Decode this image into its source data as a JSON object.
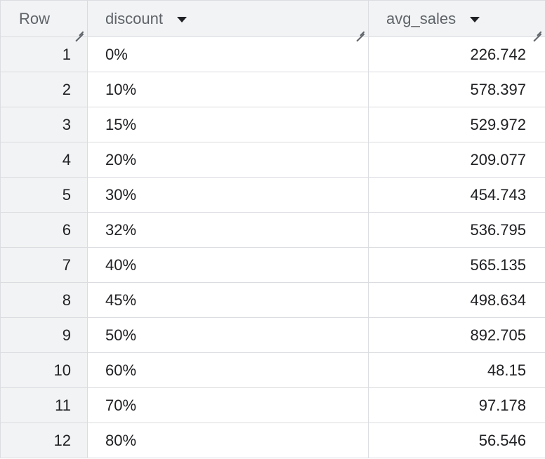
{
  "table": {
    "columns": {
      "row": "Row",
      "discount": "discount",
      "avg_sales": "avg_sales"
    },
    "rows": [
      {
        "row": "1",
        "discount": "0%",
        "avg_sales": "226.742"
      },
      {
        "row": "2",
        "discount": "10%",
        "avg_sales": "578.397"
      },
      {
        "row": "3",
        "discount": "15%",
        "avg_sales": "529.972"
      },
      {
        "row": "4",
        "discount": "20%",
        "avg_sales": "209.077"
      },
      {
        "row": "5",
        "discount": "30%",
        "avg_sales": "454.743"
      },
      {
        "row": "6",
        "discount": "32%",
        "avg_sales": "536.795"
      },
      {
        "row": "7",
        "discount": "40%",
        "avg_sales": "565.135"
      },
      {
        "row": "8",
        "discount": "45%",
        "avg_sales": "498.634"
      },
      {
        "row": "9",
        "discount": "50%",
        "avg_sales": "892.705"
      },
      {
        "row": "10",
        "discount": "60%",
        "avg_sales": "48.15"
      },
      {
        "row": "11",
        "discount": "70%",
        "avg_sales": "97.178"
      },
      {
        "row": "12",
        "discount": "80%",
        "avg_sales": "56.546"
      }
    ]
  },
  "colors": {
    "header_bg": "#f1f3f4",
    "border": "#dadce0",
    "header_text": "#5f6368",
    "cell_text": "#202124"
  },
  "icons": {
    "sort": "caret-down-icon",
    "resize": "column-resize-handle"
  }
}
